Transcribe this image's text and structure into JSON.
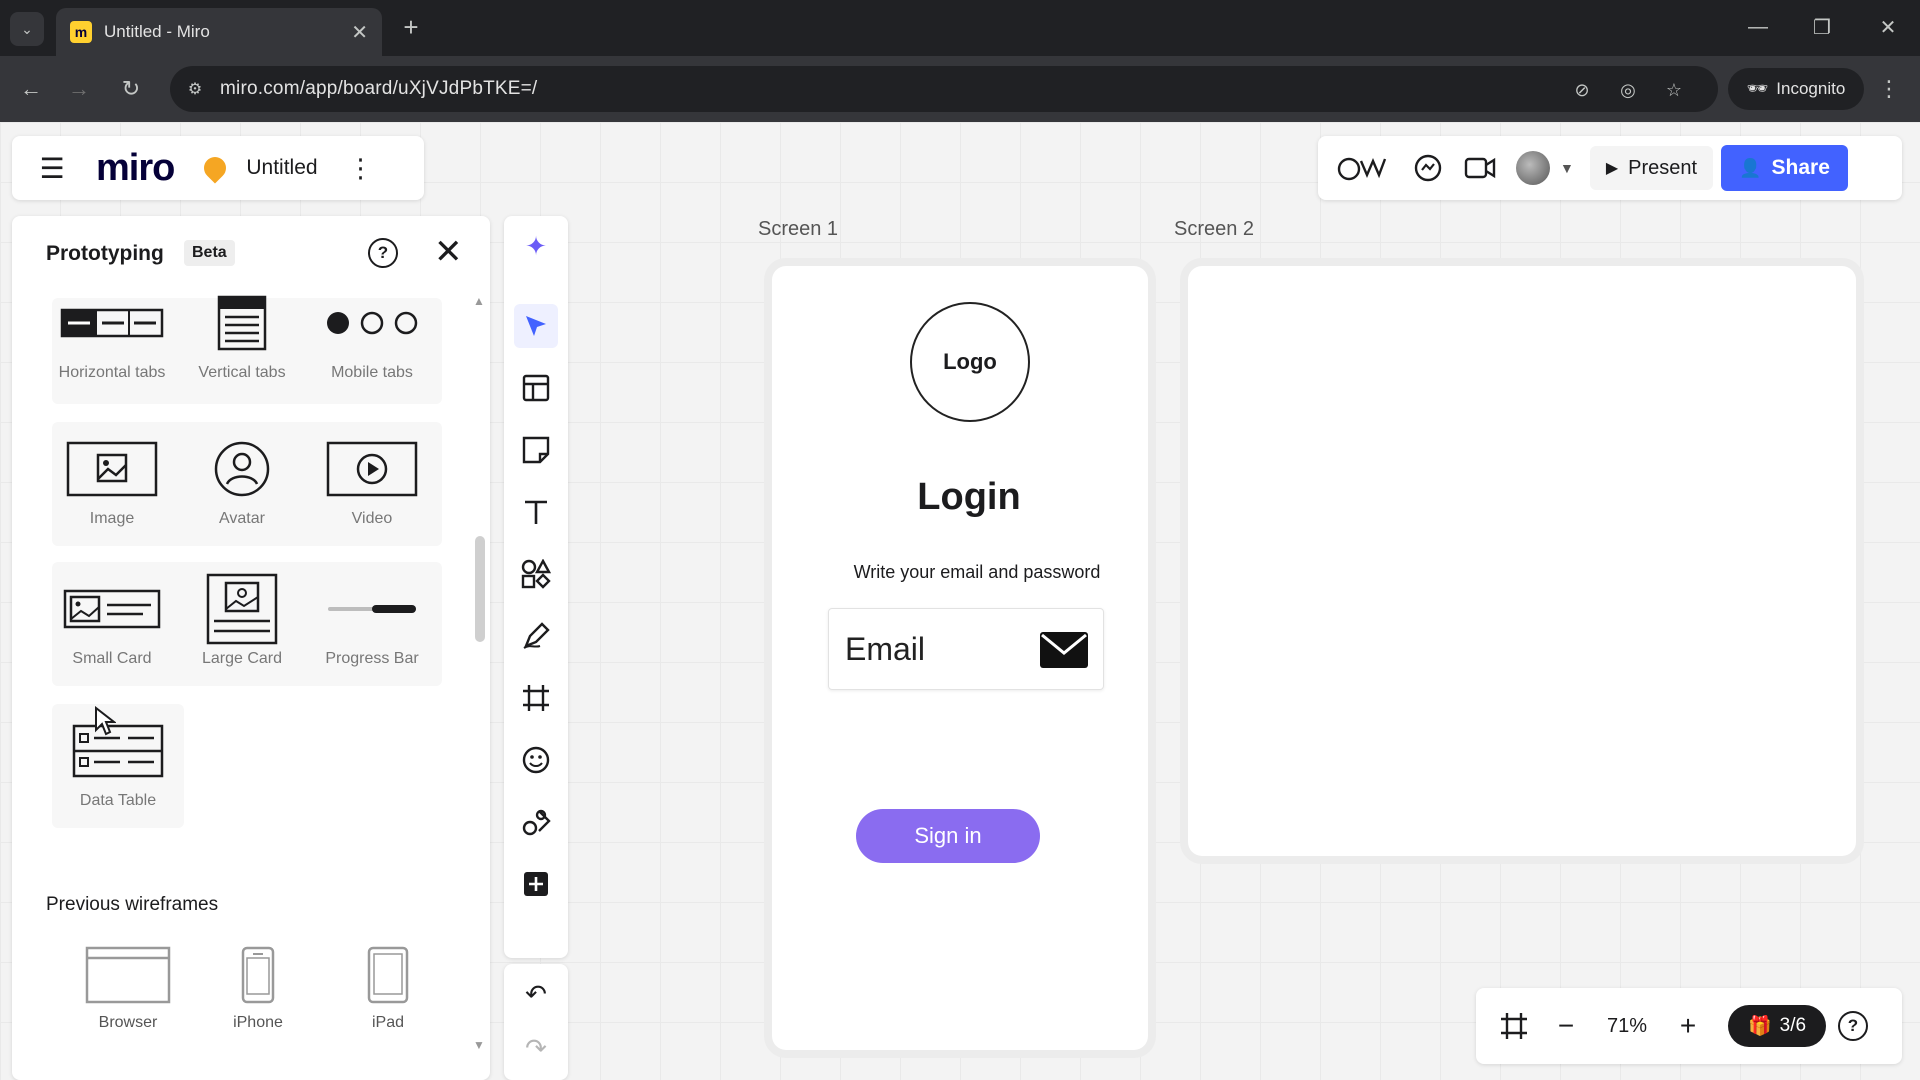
{
  "browser": {
    "tab_title": "Untitled - Miro",
    "url": "miro.com/app/board/uXjVJdPbTKE=/",
    "incognito_label": "Incognito"
  },
  "board": {
    "logo": "miro",
    "name": "Untitled"
  },
  "toolbar": {
    "present_label": "Present",
    "share_label": "Share"
  },
  "prototyping": {
    "title": "Prototyping",
    "badge": "Beta",
    "tiles": [
      {
        "label": "Horizontal tabs",
        "icon": "horizontal-tabs-icon"
      },
      {
        "label": "Vertical tabs",
        "icon": "vertical-tabs-icon"
      },
      {
        "label": "Mobile tabs",
        "icon": "mobile-tabs-icon"
      },
      {
        "label": "Image",
        "icon": "image-icon"
      },
      {
        "label": "Avatar",
        "icon": "avatar-icon"
      },
      {
        "label": "Video",
        "icon": "video-icon"
      },
      {
        "label": "Small Card",
        "icon": "small-card-icon"
      },
      {
        "label": "Large Card",
        "icon": "large-card-icon"
      },
      {
        "label": "Progress Bar",
        "icon": "progress-bar-icon"
      },
      {
        "label": "Data Table",
        "icon": "data-table-icon"
      }
    ],
    "previous_title": "Previous wireframes",
    "devices": [
      {
        "label": "Browser"
      },
      {
        "label": "iPhone"
      },
      {
        "label": "iPad"
      }
    ]
  },
  "frames": {
    "screen1_label": "Screen 1",
    "screen2_label": "Screen 2",
    "logo_text": "Logo",
    "login_title": "Login",
    "login_subtitle": "Write your email and password",
    "email_placeholder": "Email",
    "signin_label": "Sign in"
  },
  "bottom": {
    "zoom": "71%",
    "credits": "3/6"
  },
  "colors": {
    "accent": "#4262ff",
    "signin": "#8a6cf0",
    "pin": "#f5a623"
  }
}
